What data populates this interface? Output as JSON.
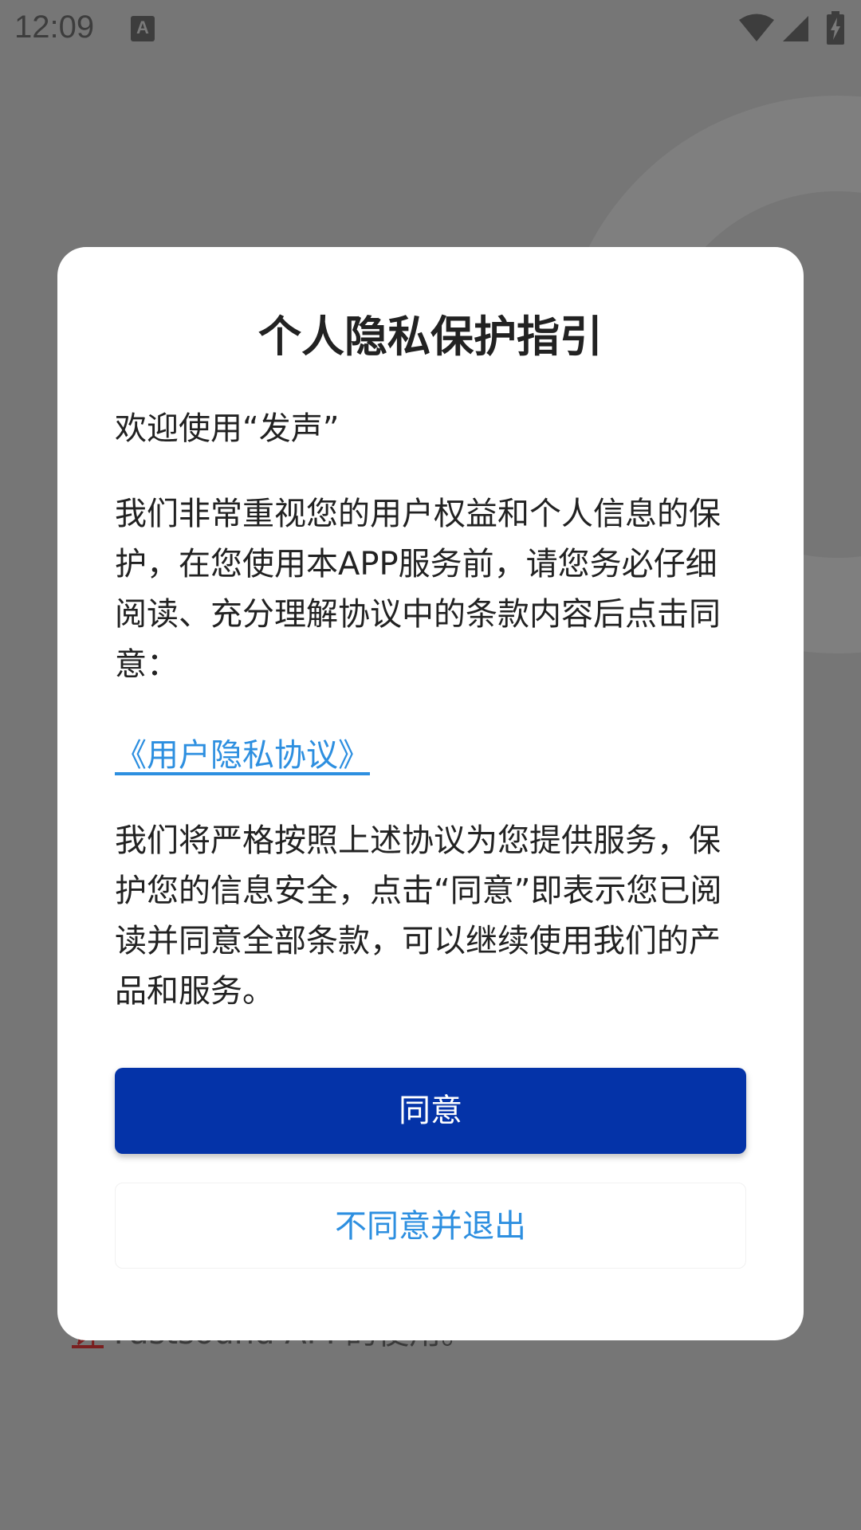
{
  "status_bar": {
    "time": "12:09",
    "keyboard_icon_letter": "A",
    "icons": [
      "keyboard-indicator-icon",
      "wifi-icon",
      "cell-signal-icon",
      "battery-charging-icon"
    ]
  },
  "background": {
    "text_link": "许",
    "text_rest": " Fastsound API 的使用。"
  },
  "dialog": {
    "title": "个人隐私保护指引",
    "welcome": "欢迎使用“发声”",
    "intro": "我们非常重视您的用户权益和个人信息的保护，在您使用本APP服务前，请您务必仔细阅读、充分理解协议中的条款内容后点击同意：",
    "policy_link": "《用户隐私协议》",
    "closing": "我们将严格按照上述协议为您提供服务，保护您的信息安全，点击“同意”即表示您已阅读并同意全部条款，可以继续使用我们的产品和服务。",
    "agree_label": "同意",
    "disagree_label": "不同意并退出"
  },
  "colors": {
    "primary_button": "#0433a8",
    "link": "#2d8fe0",
    "scrim": "#767676"
  }
}
